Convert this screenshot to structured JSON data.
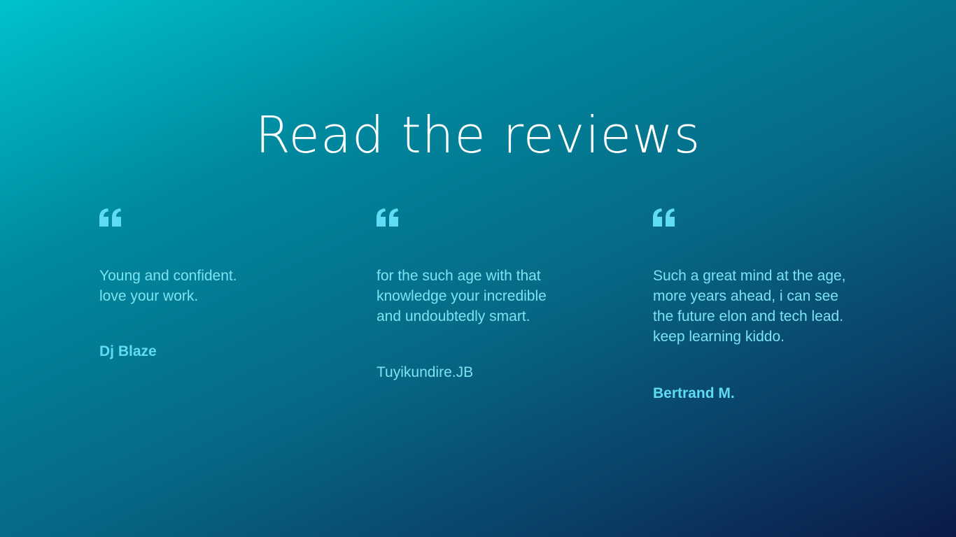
{
  "page": {
    "title": "Read the reviews"
  },
  "colors": {
    "accent": "#5fdcf3",
    "text": "#7be3f1",
    "title": "#ffffff",
    "gradient_start": "#00c2cd",
    "gradient_end": "#0b1a47"
  },
  "reviews": [
    {
      "icon": "quote-icon",
      "text": "Young and confident. love your work.",
      "author": "Dj Blaze"
    },
    {
      "icon": "quote-icon",
      "text": "for the such age with that knowledge your incredible and undoubtedly smart.",
      "author": "Tuyikundire.JB"
    },
    {
      "icon": "quote-icon",
      "text": "Such a great mind at the age, more years ahead, i can see the future elon and tech lead. keep learning kiddo.",
      "author": "Bertrand M."
    }
  ]
}
